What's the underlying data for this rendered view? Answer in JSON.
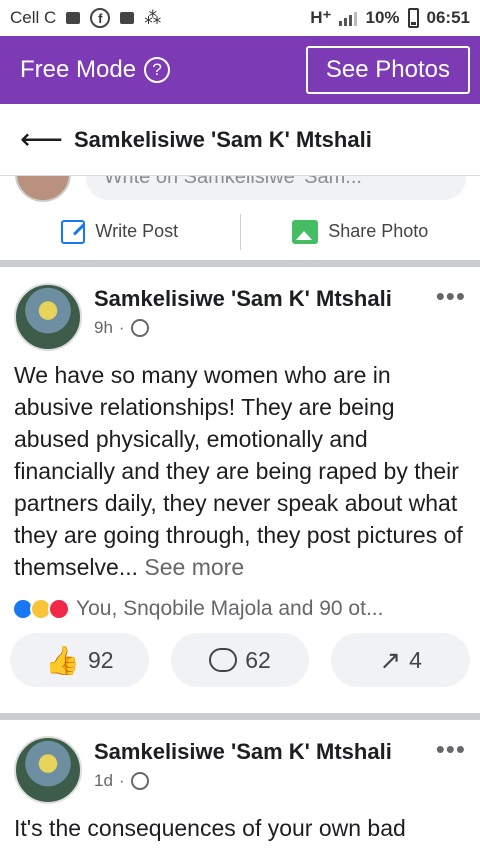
{
  "status_bar": {
    "carrier": "Cell C",
    "network": "H⁺",
    "battery": "10%",
    "time": "06:51"
  },
  "free_mode": {
    "label": "Free Mode",
    "see_photos": "See Photos"
  },
  "header": {
    "title": "Samkelisiwe 'Sam K' Mtshali"
  },
  "composer": {
    "placeholder": "Write on Samkelisiwe 'Sam..."
  },
  "actions": {
    "write_post": "Write Post",
    "share_photo": "Share Photo"
  },
  "posts": [
    {
      "author": "Samkelisiwe 'Sam K' Mtshali",
      "time": "9h",
      "text": "We have so many women who are in abusive relationships! They are being abused physically, emotionally and financially and they are being raped by their partners daily, they never speak about what they are going through, they post pictures of themselve...",
      "see_more": "See more",
      "reactions": "You, Snqobile Majola and 90 ot...",
      "likes": "92",
      "comments": "62",
      "shares": "4"
    },
    {
      "author": "Samkelisiwe 'Sam K' Mtshali",
      "time": "1d",
      "text": "It's the consequences of your own bad"
    }
  ],
  "icons": {
    "accent": "#7c3ab5",
    "link_blue": "#1877f2"
  }
}
